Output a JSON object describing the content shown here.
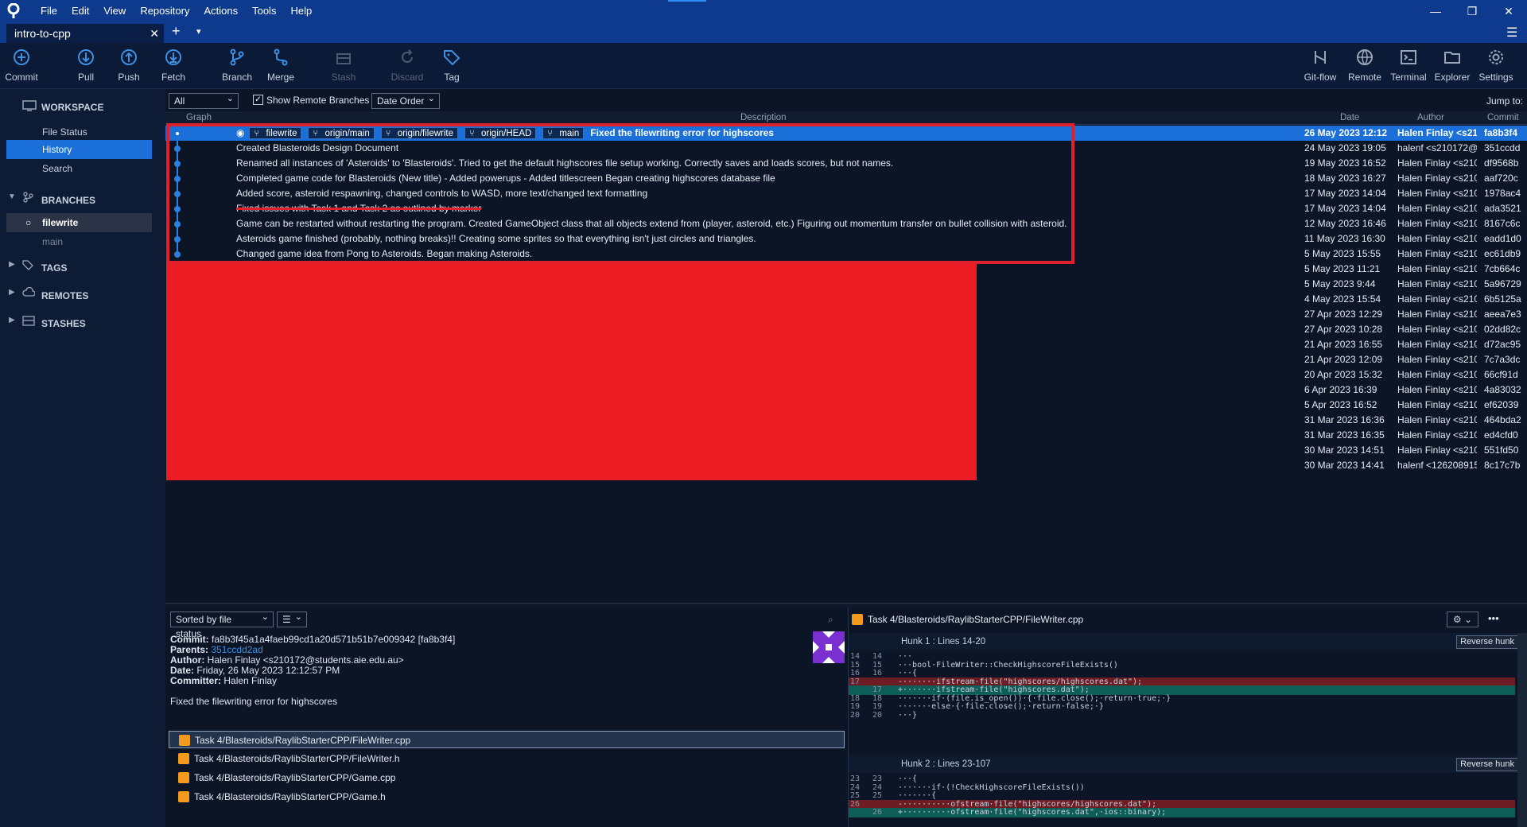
{
  "app": {
    "menu": [
      "File",
      "Edit",
      "View",
      "Repository",
      "Actions",
      "Tools",
      "Help"
    ],
    "window_controls": {
      "minimize": "—",
      "restore": "❐",
      "close": "✕"
    },
    "tab": {
      "label": "intro-to-cpp",
      "close": "✕",
      "new": "+",
      "more": "▾"
    },
    "hamburger": "☰"
  },
  "toolbar": {
    "commit": "Commit",
    "pull": "Pull",
    "push": "Push",
    "fetch": "Fetch",
    "branch": "Branch",
    "merge": "Merge",
    "stash": "Stash",
    "discard": "Discard",
    "tag": "Tag",
    "gitflow": "Git-flow",
    "remote": "Remote",
    "terminal": "Terminal",
    "explorer": "Explorer",
    "settings": "Settings"
  },
  "sidebar": {
    "workspace": "WORKSPACE",
    "file_status": "File Status",
    "history": "History",
    "search": "Search",
    "branches": "BRANCHES",
    "branch_current": "filewrite",
    "branch_other": "main",
    "tags": "TAGS",
    "remotes": "REMOTES",
    "stashes": "STASHES"
  },
  "history_bar": {
    "branches_filter": "All Branches",
    "show_remote": "Show Remote Branches",
    "order": "Date Order",
    "jump_to": "Jump to:"
  },
  "columns": {
    "graph": "Graph",
    "description": "Description",
    "date": "Date",
    "author": "Author",
    "commit": "Commit"
  },
  "selected_refs": [
    "filewrite",
    "origin/main",
    "origin/filewrite",
    "origin/HEAD",
    "main"
  ],
  "commits": [
    {
      "desc": "Fixed the filewriting error for highscores",
      "date": "26 May 2023 12:12",
      "author": "Halen Finlay <s21(",
      "hash": "fa8b3f4"
    },
    {
      "desc": "Created Blasteroids Design Document",
      "date": "24 May 2023 19:05",
      "author": "halenf <s210172@:",
      "hash": "351ccdd"
    },
    {
      "desc": "Renamed all instances of 'Asteroids' to 'Blasteroids'. Tried to get the default highscores file setup working. Correctly saves and loads scores, but not names.",
      "date": "19 May 2023 16:52",
      "author": "Halen Finlay <s210",
      "hash": "df9568b"
    },
    {
      "desc": "Completed game code for Blasteroids (New title) - Added powerups - Added titlescreen Began creating highscores database file",
      "date": "18 May 2023 16:27",
      "author": "Halen Finlay <s210",
      "hash": "aaf720c"
    },
    {
      "desc": "Added score, asteroid respawning, changed controls to WASD, more text/changed text formatting",
      "date": "17 May 2023 14:04",
      "author": "Halen Finlay <s210",
      "hash": "1978ac4"
    },
    {
      "desc": "Fixed issues with Task 1 and Task 2 as outlined by marker",
      "date": "17 May 2023 14:04",
      "author": "Halen Finlay <s210",
      "hash": "ada3521"
    },
    {
      "desc": "Game can be restarted without restarting the program. Created GameObject class that all objects extend from (player, asteroid, etc.) Figuring out momentum transfer on bullet collision with asteroid.",
      "date": "12 May 2023 16:46",
      "author": "Halen Finlay <s210",
      "hash": "8167c6c"
    },
    {
      "desc": "Asteroids game finished (probably, nothing breaks)!! Creating some sprites so that everything isn't just circles and triangles.",
      "date": "11 May 2023 16:30",
      "author": "Halen Finlay <s210",
      "hash": "eadd1d0"
    },
    {
      "desc": "Changed game idea from Pong to Asteroids. Began making Asteroids.",
      "date": "5 May 2023 15:55",
      "author": "Halen Finlay <s210",
      "hash": "ec61db9"
    },
    {
      "desc": "",
      "date": "5 May 2023 11:21",
      "author": "Halen Finlay <s210",
      "hash": "7cb664c"
    },
    {
      "desc": "",
      "date": "5 May 2023 9:44",
      "author": "Halen Finlay <s210",
      "hash": "5a96729"
    },
    {
      "desc": "",
      "date": "4 May 2023 15:54",
      "author": "Halen Finlay <s210",
      "hash": "6b5125a"
    },
    {
      "desc": "",
      "date": "27 Apr 2023 12:29",
      "author": "Halen Finlay <s210",
      "hash": "aeea7e3"
    },
    {
      "desc": "",
      "date": "27 Apr 2023 10:28",
      "author": "Halen Finlay <s210",
      "hash": "02dd82c"
    },
    {
      "desc": "",
      "date": "21 Apr 2023 16:55",
      "author": "Halen Finlay <s210",
      "hash": "d72ac95"
    },
    {
      "desc": "",
      "date": "21 Apr 2023 12:09",
      "author": "Halen Finlay <s210",
      "hash": "7c7a3dc"
    },
    {
      "desc": "",
      "date": "20 Apr 2023 15:32",
      "author": "Halen Finlay <s210",
      "hash": "66cf91d"
    },
    {
      "desc": "",
      "date": "6 Apr 2023 16:39",
      "author": "Halen Finlay <s210",
      "hash": "4a83032"
    },
    {
      "desc": "",
      "date": "5 Apr 2023 16:52",
      "author": "Halen Finlay <s210",
      "hash": "ef62039"
    },
    {
      "desc": "",
      "date": "31 Mar 2023 16:36",
      "author": "Halen Finlay <s210",
      "hash": "464bda2"
    },
    {
      "desc": "",
      "date": "31 Mar 2023 16:35",
      "author": "Halen Finlay <s210",
      "hash": "ed4cfd0"
    },
    {
      "desc": "",
      "date": "30 Mar 2023 14:51",
      "author": "Halen Finlay <s210",
      "hash": "551fd50"
    },
    {
      "desc": "",
      "date": "30 Mar 2023 14:41",
      "author": "halenf <126208915",
      "hash": "8c17c7b"
    }
  ],
  "details": {
    "sort": "Sorted by file status",
    "list_mode": "☰",
    "commit_label": "Commit:",
    "commit_value": "fa8b3f45a1a4faeb99cd1a20d571b51b7e009342 [fa8b3f4]",
    "parents_label": "Parents:",
    "parents_value": "351ccdd2ad",
    "author_label": "Author:",
    "author_value": "Halen Finlay <s210172@students.aie.edu.au>",
    "date_label": "Date:",
    "date_value": "Friday, 26 May 2023 12:12:57 PM",
    "committer_label": "Committer:",
    "committer_value": "Halen Finlay",
    "message": "Fixed the filewriting error for highscores",
    "files": [
      "Task 4/Blasteroids/RaylibStarterCPP/FileWriter.cpp",
      "Task 4/Blasteroids/RaylibStarterCPP/FileWriter.h",
      "Task 4/Blasteroids/RaylibStarterCPP/Game.cpp",
      "Task 4/Blasteroids/RaylibStarterCPP/Game.h"
    ]
  },
  "diff": {
    "file": "Task 4/Blasteroids/RaylibStarterCPP/FileWriter.cpp",
    "more": "•••",
    "hunk1": {
      "title": "Hunk 1 : Lines 14-20",
      "reverse": "Reverse hunk",
      "lines": [
        {
          "o": "14",
          "n": "14",
          "t": "···",
          "k": "ctx"
        },
        {
          "o": "15",
          "n": "15",
          "t": "···bool·FileWriter::CheckHighscoreFileExists()",
          "k": "ctx"
        },
        {
          "o": "16",
          "n": "16",
          "t": "···{",
          "k": "ctx"
        },
        {
          "o": "17",
          "n": "",
          "t": "-·······ifstream·file(\"highscores/highscores.dat\");",
          "k": "del"
        },
        {
          "o": "",
          "n": "17",
          "t": "+·······ifstream·file(\"highscores.dat\");",
          "k": "add"
        },
        {
          "o": "18",
          "n": "18",
          "t": "·······if·(file.is_open())·{·file.close();·return·true;·}",
          "k": "ctx"
        },
        {
          "o": "19",
          "n": "19",
          "t": "·······else·{·file.close();·return·false;·}",
          "k": "ctx"
        },
        {
          "o": "20",
          "n": "20",
          "t": "···}",
          "k": "ctx"
        }
      ]
    },
    "hunk2": {
      "title": "Hunk 2 : Lines 23-107",
      "reverse": "Reverse hunk",
      "lines": [
        {
          "o": "23",
          "n": "23",
          "t": "···{",
          "k": "ctx"
        },
        {
          "o": "24",
          "n": "24",
          "t": "·······if·(!CheckHighscoreFileExists())",
          "k": "ctx"
        },
        {
          "o": "25",
          "n": "25",
          "t": "·······{",
          "k": "ctx"
        },
        {
          "o": "26",
          "n": "",
          "t": "-··········ofstream·file(\"highscores/highscores.dat\");",
          "k": "del"
        },
        {
          "o": "",
          "n": "26",
          "t": "+··········ofstream·file(\"highscores.dat\",·ios::binary);",
          "k": "add"
        }
      ]
    }
  }
}
